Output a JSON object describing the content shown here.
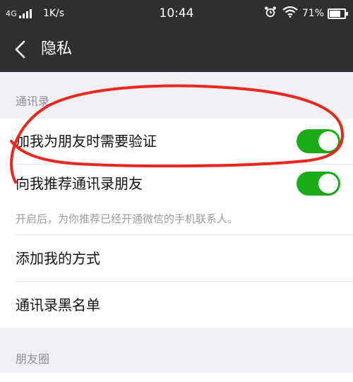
{
  "status_bar": {
    "network": "4G",
    "speed": "1K/s",
    "time": "10:44",
    "battery": "71%",
    "battery_level": 0.71,
    "icons": [
      "signal-icon",
      "alarm-icon",
      "wifi-icon",
      "battery-icon"
    ]
  },
  "nav": {
    "back_icon": "chevron-left-icon",
    "title": "隐私"
  },
  "sections": {
    "contacts_header": "通讯录",
    "moments_header": "朋友圈"
  },
  "contacts": {
    "verify_label": "加我为朋友时需要验证",
    "verify_on": true,
    "recommend_label": "向我推荐通讯录朋友",
    "recommend_on": true,
    "recommend_hint": "开启后，为你推荐已经开通微信的手机联系人。"
  },
  "more": {
    "add_methods_label": "添加我的方式",
    "blacklist_label": "通讯录黑名单"
  },
  "colors": {
    "header_bg": "#2f2f31",
    "page_bg": "#efeff4",
    "toggle_on": "#1aad19",
    "annotation": "#e8281e"
  }
}
